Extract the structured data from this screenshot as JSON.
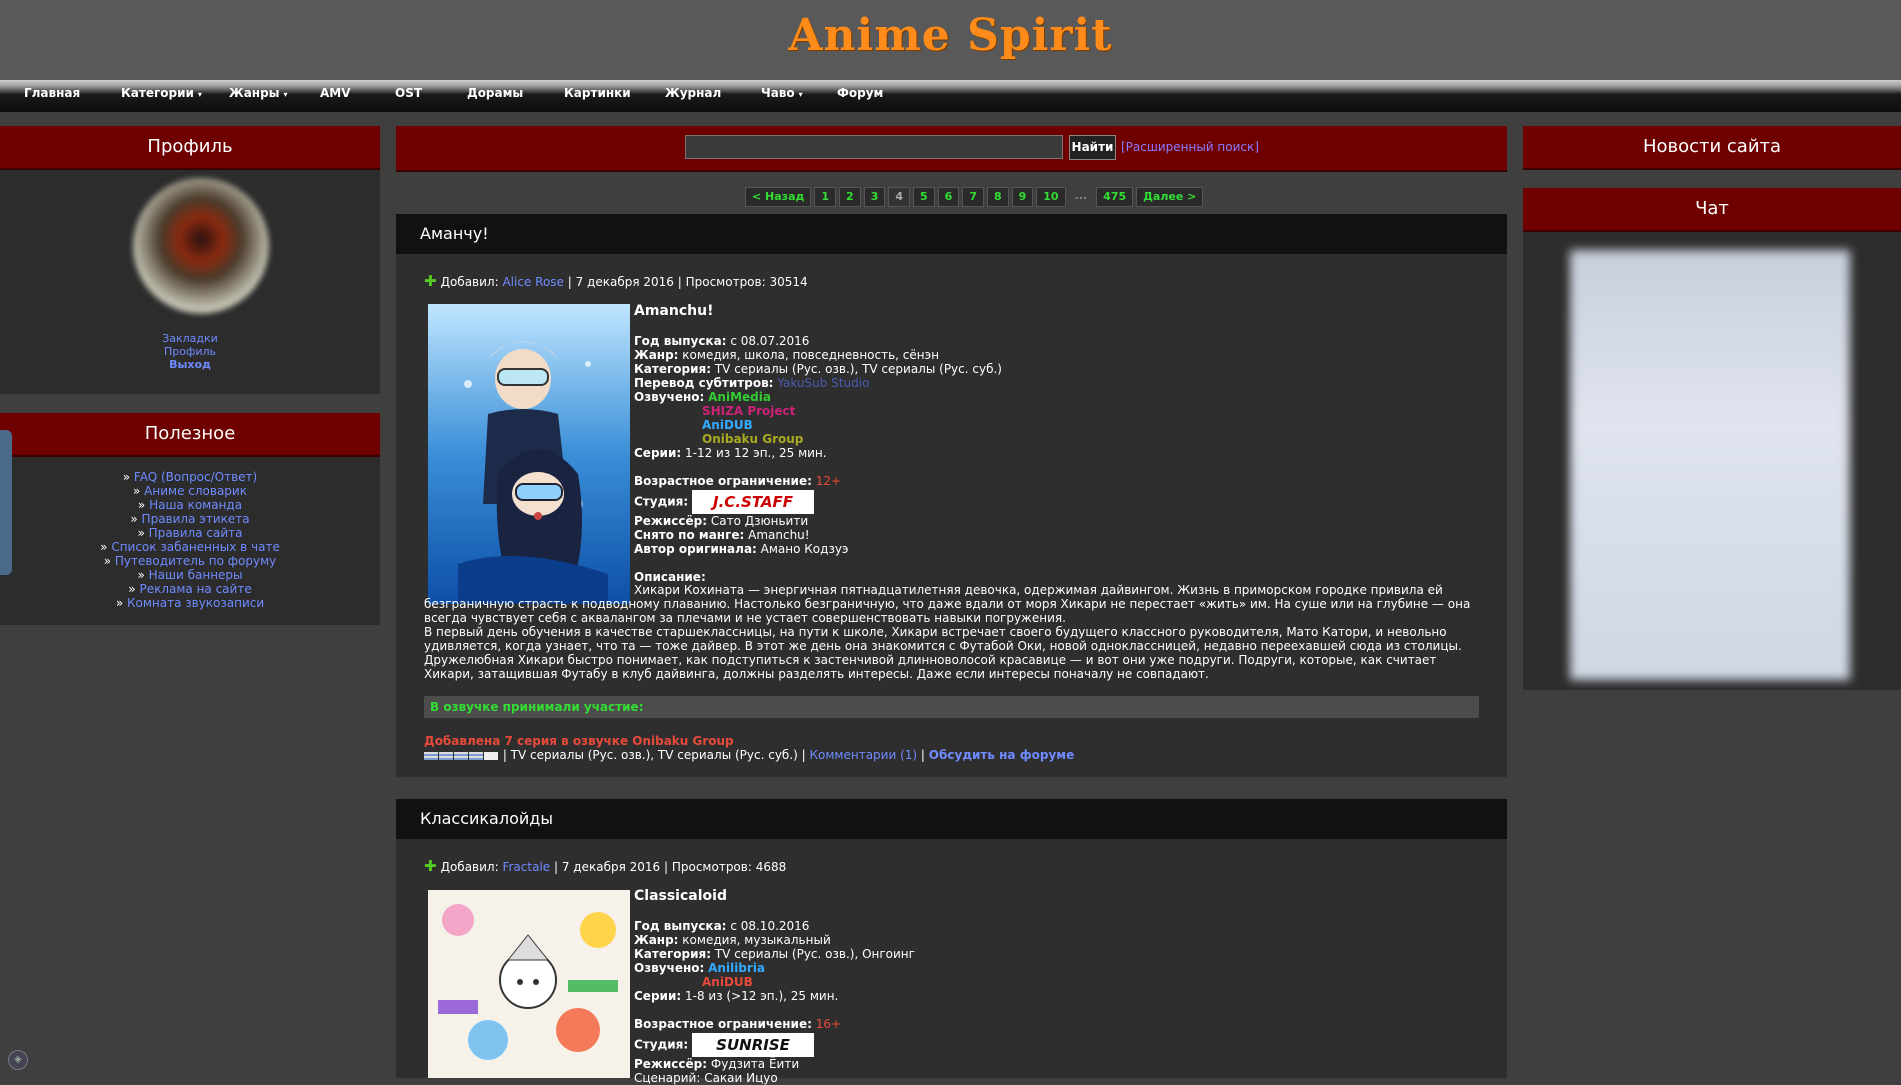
{
  "site": {
    "logo": "Anime Spirit"
  },
  "nav": [
    {
      "label": "Главная"
    },
    {
      "label": "Категории",
      "caret": "▾"
    },
    {
      "label": "Жанры",
      "caret": "▾"
    },
    {
      "label": "AMV"
    },
    {
      "label": "OST"
    },
    {
      "label": "Дорамы"
    },
    {
      "label": "Картинки"
    },
    {
      "label": "Журнал"
    },
    {
      "label": "Чаво",
      "caret": "▾"
    },
    {
      "label": "Форум"
    }
  ],
  "left": {
    "profile_title": "Профиль",
    "profile_links": [
      "Закладки",
      "Профиль",
      "Выход"
    ],
    "useful_title": "Полезное",
    "useful_links": [
      "FAQ (Вопрос/Ответ)",
      "Аниме словарик",
      "Наша команда",
      "Правила этикета",
      "Правила сайта",
      "Список забаненных в чате",
      "Путеводитель по форуму",
      "Наши баннеры",
      "Реклама на сайте",
      "Комната звукозаписи"
    ]
  },
  "search": {
    "button": "Найти",
    "advanced": "[Расширенный поиск]"
  },
  "pager": [
    "< Назад",
    "1",
    "2",
    "3",
    "4",
    "5",
    "6",
    "7",
    "8",
    "9",
    "10",
    "...",
    "475",
    "Далее >"
  ],
  "pager_current": "4",
  "right": {
    "news_title": "Новости сайта",
    "chat_title": "Чат"
  },
  "posts": [
    {
      "heading": "Аманчу!",
      "meta_prefix": "Добавил:",
      "author": "Alice Rose",
      "meta_rest": "| 7 декабря 2016 | Просмотров: 30514",
      "title": "Amanchu!",
      "year_label": "Год выпуска:",
      "year": "с 08.07.2016",
      "genre_label": "Жанр:",
      "genre": "комедия, школа, повседневность, сёнэн",
      "category_label": "Категория:",
      "category": "TV сериалы (Рус. озв.), TV сериалы (Рус. суб.)",
      "subs_label": "Перевод субтитров:",
      "subs": "YakuSub Studio",
      "voiced_label": "Озвучено:",
      "voiced": [
        {
          "name": "AniMedia",
          "color": "#33cc33"
        },
        {
          "name": "SHIZA Project",
          "color": "#cc2277"
        },
        {
          "name": "AniDUB",
          "color": "#33aaff"
        },
        {
          "name": "Onibaku Group",
          "color": "#aaaa22"
        }
      ],
      "episodes_label": "Серии:",
      "episodes": "1-12 из 12 эп., 25 мин.",
      "age_label": "Возрастное ограничение:",
      "age": "12+",
      "studio_label": "Студия:",
      "studio": "J.C.STAFF",
      "director_label": "Режиссёр:",
      "director": "Сато Дзюньити",
      "manga_label": "Снято по манге:",
      "manga": "Amanchu!",
      "author_label": "Автор оригинала:",
      "original_author": "Амано Кодзуэ",
      "desc_label": "Описание:",
      "desc_1": "Хикари Кохината — энергичная пятнадцатилетняя девочка, одержимая дайвингом. Жизнь в приморском городке привила ей безграничную страсть к подводному плаванию. Настолько безграничную, что даже вдали от моря Хикари не перестает «жить» им. На суше или на глубине — она всегда чувствует себя с аквалангом за плечами и не устает совершенствовать навыки погружения.",
      "desc_2": "В первый день обучения в качестве старшеклассницы, на пути к школе, Хикари встречает своего будущего классного руководителя, Мато Катори, и невольно удивляется, когда узнает, что та — тоже дайвер. В этот же день она знакомится с Футабой Оки, новой одноклассницей, недавно переехавшей сюда из столицы. Дружелюбная Хикари быстро понимает, как подступиться к застенчивой длинноволосой красавице — и вот они уже подруги. Подруги, которые, как считает Хикари, затащившая Футабу в клуб дайвинга, должны разделять интересы. Даже если интересы поначалу не совпадают.",
      "voice_box": "В озвучке принимали участие:",
      "added_note": "Добавлена 7 серия в озвучке Onibaku Group",
      "footer_cats": "| TV сериалы (Рус. озв.), TV сериалы (Рус. суб.) |",
      "comments": "Комментарии (1)",
      "footer_sep": "|",
      "forum": "Обсудить на форуме"
    },
    {
      "heading": "Классикалойды",
      "meta_prefix": "Добавил:",
      "author": "Fractale",
      "meta_rest": "| 7 декабря 2016 | Просмотров: 4688",
      "title": "Classicaloid",
      "year_label": "Год выпуска:",
      "year": "с 08.10.2016",
      "genre_label": "Жанр:",
      "genre": "комедия, музыкальный",
      "category_label": "Категория:",
      "category": "TV сериалы (Рус. озв.), Онгоинг",
      "voiced_label": "Озвучено:",
      "voiced": [
        {
          "name": "Anilibria",
          "color": "#33aaff"
        },
        {
          "name": "AniDUB",
          "color": "#e84a3a"
        }
      ],
      "episodes_label": "Серии:",
      "episodes": "1-8 из (>12 эп.), 25 мин.",
      "age_label": "Возрастное ограничение:",
      "age": "16+",
      "studio_label": "Студия:",
      "studio": "SUNRISE",
      "director_label": "Режиссёр:",
      "director": "Фудзита Ёити",
      "script_partial": "Сценарий: Сакаи Ицуо"
    }
  ],
  "colors": {
    "header_red": "#6e0000",
    "link": "#6f8bff",
    "logo": "#ff8c1a",
    "green": "#33dd33",
    "age": "#e84a3a"
  }
}
